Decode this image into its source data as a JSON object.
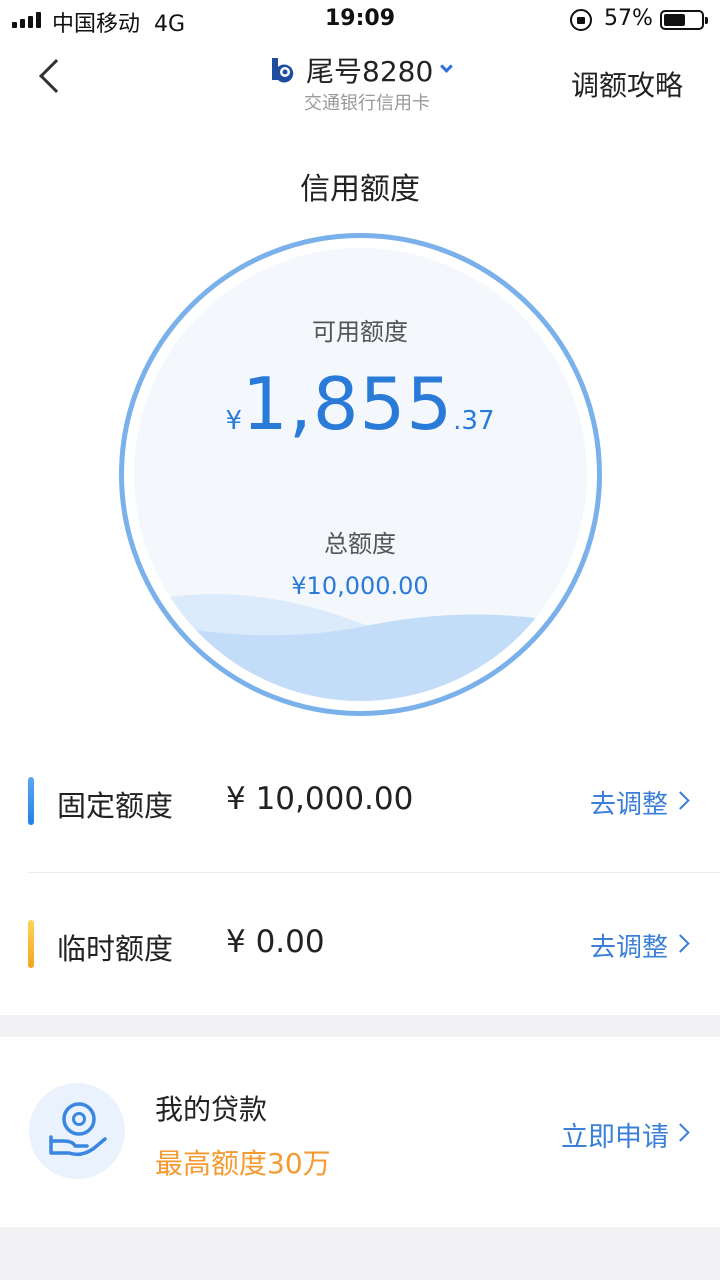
{
  "status_bar": {
    "carrier": "中国移动",
    "network": "4G",
    "time": "19:09",
    "battery_pct": "57%",
    "battery_level": 0.57
  },
  "header": {
    "card_title": "尾号8280",
    "card_subtitle": "交通银行信用卡",
    "guide_link": "调额攻略",
    "icons": [
      "back-arrow-icon",
      "bank-logo-icon",
      "chevron-down-icon"
    ]
  },
  "credit": {
    "section_title": "信用额度",
    "available_label": "可用额度",
    "available_currency": "¥",
    "available_integer": "1,855",
    "available_decimal": ".37",
    "total_label": "总额度",
    "total_value": "¥10,000.00",
    "accent_color": "#2a7ad8"
  },
  "quotas": [
    {
      "label": "固定额度",
      "value": "¥ 10,000.00",
      "action": "去调整",
      "bar_color": "#2380e3"
    },
    {
      "label": "临时额度",
      "value": "¥ 0.00",
      "action": "去调整",
      "bar_color": "#f2a51f"
    }
  ],
  "loan": {
    "title": "我的贷款",
    "subtitle": "最高额度30万",
    "action": "立即申请",
    "subtitle_color": "#f49a30",
    "icon": "coin-hand-icon"
  }
}
